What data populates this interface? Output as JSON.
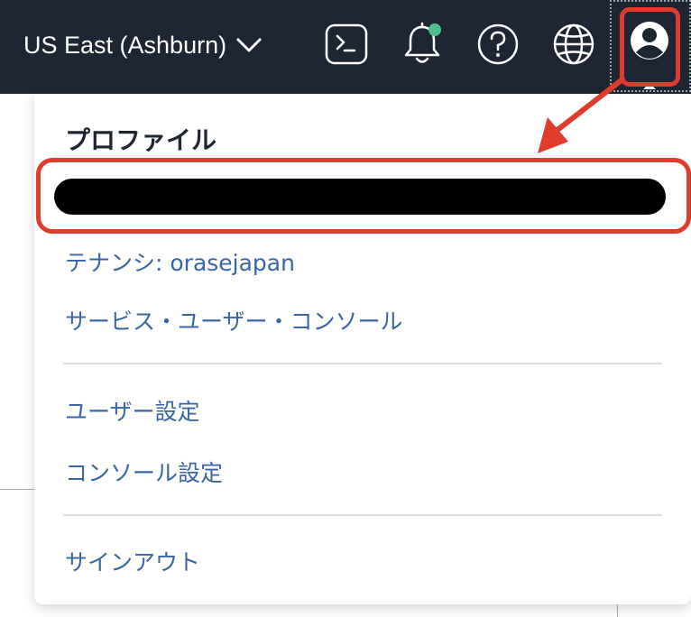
{
  "header": {
    "region_label": "US East (Ashburn)",
    "icons": [
      "terminal-icon",
      "bell-icon",
      "help-icon",
      "globe-icon",
      "user-avatar-icon"
    ],
    "notification_dot_color": "#4fc08d"
  },
  "profile_menu": {
    "title": "プロファイル",
    "user_name_redacted": true,
    "items": [
      {
        "label": "テナンシ: orasejapan"
      },
      {
        "label": "サービス・ユーザー・コンソール"
      },
      {
        "label": "ユーザー設定"
      },
      {
        "label": "コンソール設定"
      },
      {
        "label": "サインアウト"
      }
    ]
  },
  "annotations": {
    "highlight_color": "#e03c2c"
  }
}
